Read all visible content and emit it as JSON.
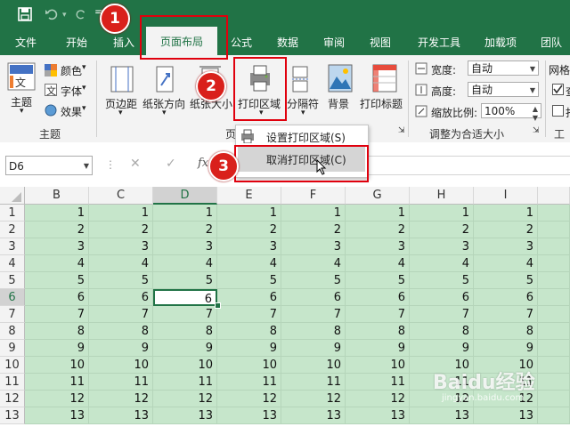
{
  "quick_access": {
    "save_icon": "save-icon",
    "undo_icon": "undo-icon",
    "redo_icon": "redo-icon",
    "customize_icon": "customize-icon"
  },
  "tabs": [
    {
      "label": "文件",
      "active": false
    },
    {
      "label": "开始",
      "active": false
    },
    {
      "label": "插入",
      "active": false
    },
    {
      "label": "页面布局",
      "active": true
    },
    {
      "label": "公式",
      "active": false
    },
    {
      "label": "数据",
      "active": false
    },
    {
      "label": "审阅",
      "active": false
    },
    {
      "label": "视图",
      "active": false
    },
    {
      "label": "开发工具",
      "active": false
    },
    {
      "label": "加载项",
      "active": false
    },
    {
      "label": "团队",
      "active": false
    }
  ],
  "ribbon": {
    "theme": {
      "main_label": "主题",
      "color_label": "颜色",
      "font_label": "字体",
      "effect_label": "效果",
      "group_label": "主题"
    },
    "page_setup": {
      "margins": "页边距",
      "orientation": "纸张方向",
      "size": "纸张大小",
      "print_area": "打印区域",
      "breaks": "分隔符",
      "background": "背景",
      "print_titles": "打印标题",
      "group_label_partial": "页"
    },
    "scale": {
      "width_label": "宽度:",
      "width_value": "自动",
      "height_label": "高度:",
      "height_value": "自动",
      "zoom_label": "缩放比例:",
      "zoom_value": "100%",
      "group_label": "调整为合适大小"
    },
    "sheet_options": {
      "label": "网格",
      "view_label": "查",
      "print_label": "打",
      "group_label_partial": "工"
    }
  },
  "dropdown": {
    "set_print_area": "设置打印区域(S)",
    "clear_print_area": "取消打印区域(C)"
  },
  "formula_bar": {
    "name_box": "D6",
    "cancel_icon": "cancel-icon",
    "enter_icon": "enter-icon",
    "fx_label": "fx",
    "value": ""
  },
  "sheet": {
    "columns": [
      "B",
      "C",
      "D",
      "E",
      "F",
      "G",
      "H",
      "I"
    ],
    "selected_column": "D",
    "rows": [
      1,
      2,
      3,
      4,
      5,
      6,
      7,
      8,
      9,
      10,
      11,
      12,
      13
    ],
    "selected_row": 6,
    "active_cell": "D6"
  },
  "annotations": {
    "step1": "1",
    "step2": "2",
    "step3": "3"
  },
  "watermark": {
    "text": "Baidu经验",
    "sub": "jingyan.baidu.com"
  },
  "colors": {
    "excel_green": "#217346",
    "print_area_fill": "#c6e6cb",
    "highlight_red": "#e0000d"
  }
}
